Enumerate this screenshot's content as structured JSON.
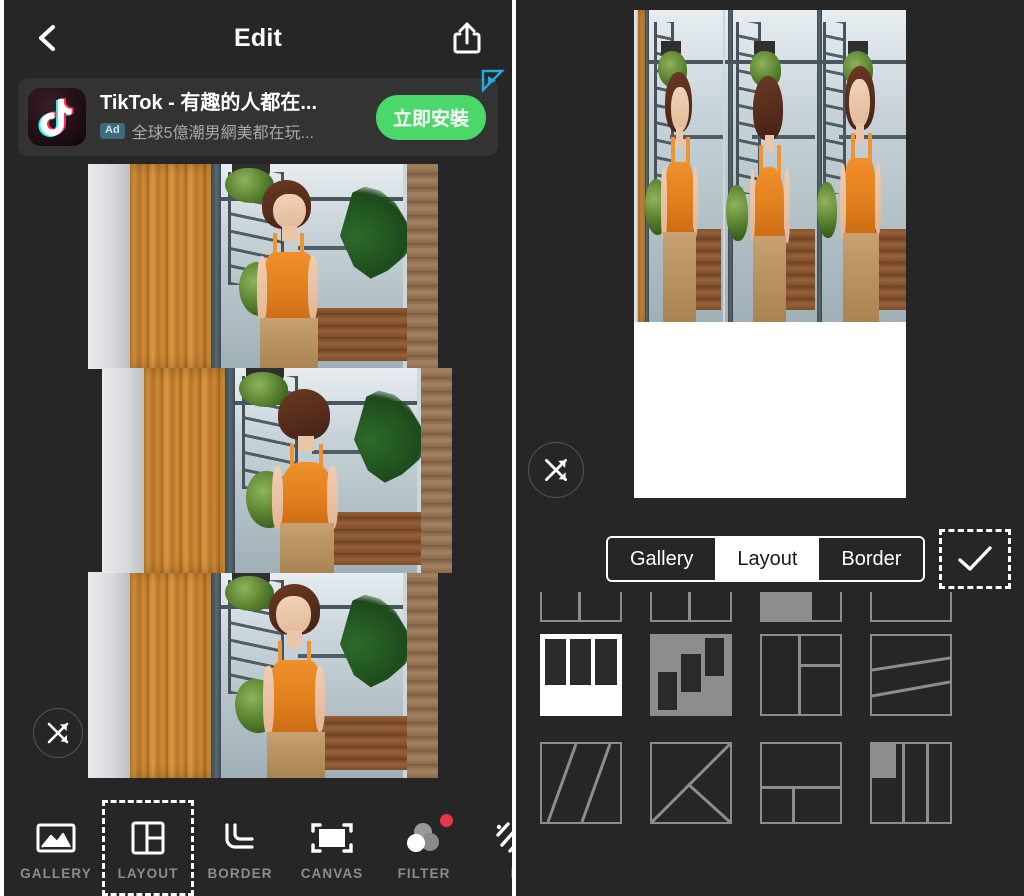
{
  "left_panel": {
    "topbar": {
      "back_icon": "chevron-left-icon",
      "title": "Edit",
      "share_icon": "share-upload-icon"
    },
    "ad": {
      "app_icon": "tiktok-logo-icon",
      "title": "TikTok - 有趣的人都在...",
      "tag": "Ad",
      "subtitle": "全球5億潮男網美都在玩...",
      "cta_label": "立即安裝",
      "ad_choices_icon": "adchoices-icon",
      "cta_color": "#4bd86a",
      "tag_color": "#3d6b7a"
    },
    "shuffle_icon": "shuffle-icon",
    "toolbar": {
      "items": [
        {
          "label": "GALLERY",
          "icon": "gallery-image-icon",
          "selected": false,
          "badge": false
        },
        {
          "label": "LAYOUT",
          "icon": "layout-grid-icon",
          "selected": true,
          "badge": false
        },
        {
          "label": "BORDER",
          "icon": "border-corner-icon",
          "selected": false,
          "badge": false
        },
        {
          "label": "CANVAS",
          "icon": "canvas-crop-icon",
          "selected": false,
          "badge": false
        },
        {
          "label": "FILTER",
          "icon": "filter-circles-icon",
          "selected": false,
          "badge": true
        },
        {
          "label": "B",
          "icon": "blur-stripes-icon",
          "selected": false,
          "badge": false
        }
      ]
    }
  },
  "right_panel": {
    "shuffle_icon": "shuffle-icon",
    "segmented": {
      "options": [
        "Gallery",
        "Layout",
        "Border"
      ],
      "selected": "Layout"
    },
    "confirm": {
      "icon": "checkmark-icon",
      "selected": true
    },
    "layout_grid": {
      "rows": [
        {
          "partial": true,
          "cells": [
            "two-col-clipped",
            "two-col-clipped",
            "two-col-filled-clipped",
            "one-col-clipped"
          ]
        },
        {
          "partial": false,
          "cells": [
            "three-col-top-selected",
            "collage-offset-bars",
            "left-big-two-right",
            "two-diagonal-stripes"
          ]
        },
        {
          "partial": false,
          "cells": [
            "double-slash",
            "triangle-split",
            "top-band-two-below",
            "three-col-stepped"
          ]
        }
      ],
      "selected_index": 0
    }
  },
  "colors": {
    "panel_bg": "#262626",
    "toolbar_label": "#8c8c8c",
    "accent_white": "#ffffff",
    "badge_red": "#e8364a",
    "thumb_stroke": "#8d8d8d"
  }
}
